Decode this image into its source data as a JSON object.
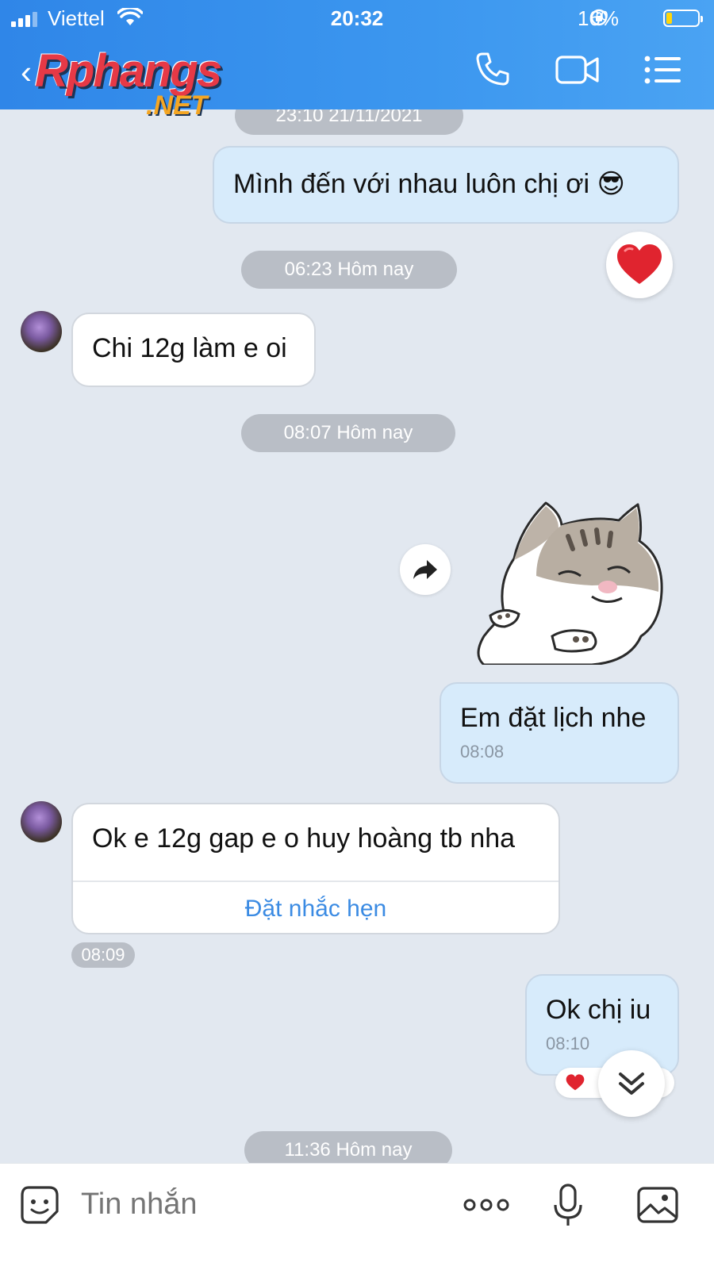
{
  "status_bar": {
    "carrier": "Viettel",
    "time": "20:32",
    "battery": "16%"
  },
  "header": {
    "logo_main": "Rphangs",
    "logo_sub": ".NET",
    "back_icon": "chevron-left-icon",
    "buttons": [
      "phone-icon",
      "video-icon",
      "menu-list-icon"
    ]
  },
  "chat": {
    "separators": {
      "first": "23:10 21/11/2021",
      "second": "06:23 Hôm nay",
      "third": "08:07 Hôm nay",
      "fourth": "11:36 Hôm nay"
    },
    "messages": [
      {
        "side": "out",
        "text": "Mình đến với nhau luôn chị ơi",
        "emoji": "😎",
        "reaction": "❤"
      },
      {
        "side": "in",
        "text": "Chi 12g làm e oi"
      },
      {
        "side": "out",
        "type": "sticker",
        "description": "cat-sticker"
      },
      {
        "side": "out",
        "text": "Em đặt lịch nhe",
        "time": "08:08"
      },
      {
        "side": "in",
        "text": "Ok e 12g gap e o huy hoàng tb nha",
        "action": "Đặt nhắc hẹn",
        "time": "08:09"
      },
      {
        "side": "out",
        "text": "Ok chị iu",
        "time": "08:10",
        "reaction": "❤"
      }
    ]
  },
  "input_bar": {
    "placeholder": "Tin nhắn",
    "icons": [
      "sticker-icon",
      "more-icon",
      "microphone-icon",
      "image-icon"
    ]
  },
  "colors": {
    "header_blue": "#3c97ef",
    "out_bubble": "#d7ebfb",
    "link_blue": "#3b8be3",
    "background": "#e2e8f0"
  }
}
